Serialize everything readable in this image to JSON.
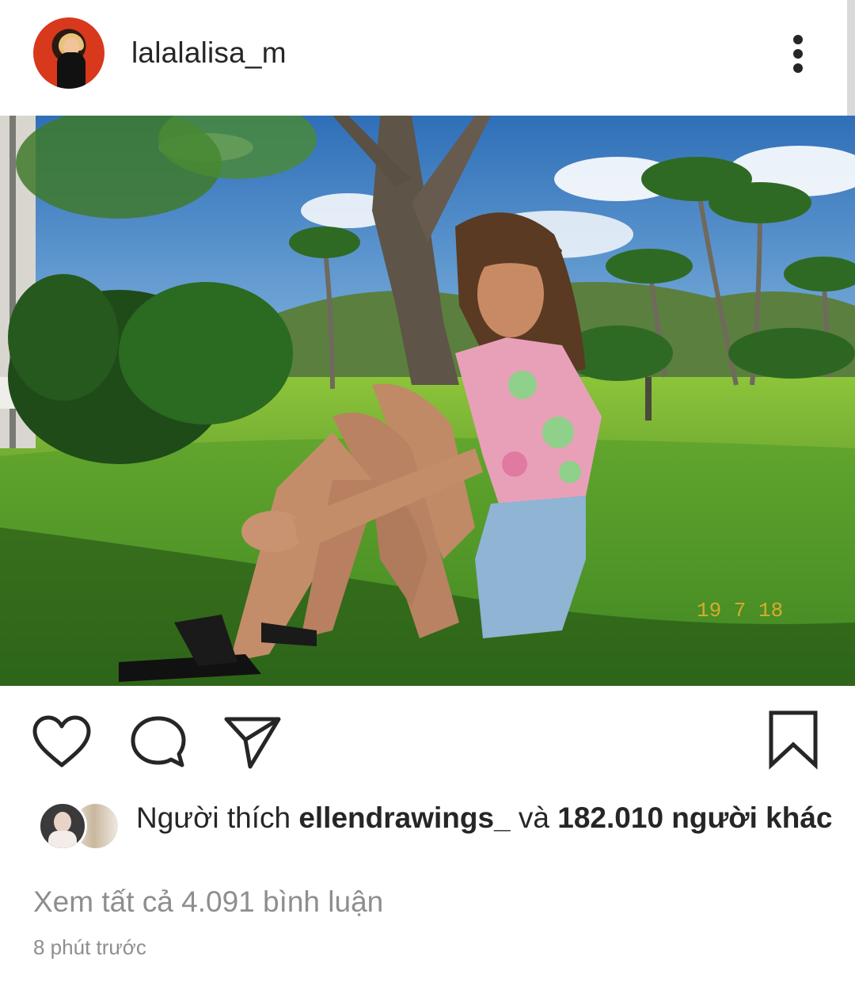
{
  "post": {
    "username": "lalalalisa_m",
    "likes": {
      "prefix": "Người thích",
      "liker": "ellendrawings_",
      "conjunction": "và",
      "others": "182.010 người khác"
    },
    "comments_link": "Xem tất cả 4.091 bình luận",
    "timestamp": "8 phút trước"
  },
  "photo": {
    "date_stamp": "19 7 18"
  },
  "icons": {
    "more": "more-vertical-icon",
    "like": "heart-icon",
    "comment": "comment-icon",
    "share": "send-icon",
    "save": "bookmark-icon"
  },
  "colors": {
    "text": "#262626",
    "secondary_text": "#8e8e8e",
    "avatar_ring": "#d8381c"
  }
}
